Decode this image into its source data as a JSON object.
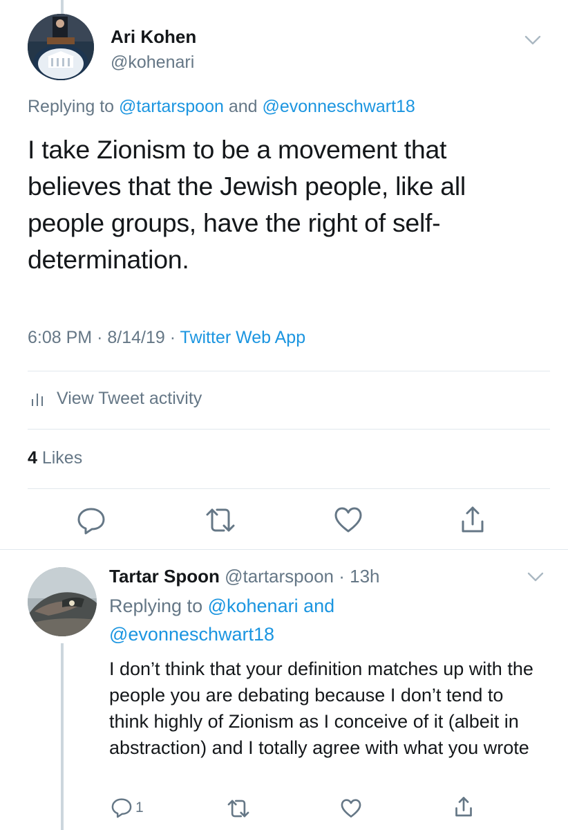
{
  "main_tweet": {
    "author_name": "Ari Kohen",
    "author_handle": "@kohenari",
    "replying_prefix": "Replying to ",
    "replying_user1": "@tartarspoon",
    "replying_and": " and ",
    "replying_user2": "@evonneschwart18",
    "text": "I take Zionism to be a movement that believes that the Jewish people, like all people groups, have the right of self-determination.",
    "time": "6:08 PM",
    "date": "8/14/19",
    "source": "Twitter Web App",
    "activity_label": "View Tweet activity",
    "likes_count": "4",
    "likes_label": " Likes"
  },
  "reply_tweet": {
    "author_name": "Tartar Spoon",
    "author_handle": "@tartarspoon",
    "age": "13h",
    "replying_prefix": "Replying to ",
    "replying_user1": "@kohenari",
    "replying_and": " and",
    "replying_user2": "@evonneschwart18",
    "text": "I don’t think that your definition matches up with the people you are debating because I don’t tend to think highly of Zionism as I conceive of it (albeit in abstraction) and I totally agree with what you wrote",
    "reply_count": "1"
  },
  "colors": {
    "accent": "#1b95e0",
    "muted": "#657786",
    "divider": "#e1e8ed",
    "icon": "#657786"
  },
  "icons": [
    "chevron-down-icon",
    "bar-chart-icon",
    "reply-icon",
    "retweet-icon",
    "like-icon",
    "share-icon"
  ]
}
